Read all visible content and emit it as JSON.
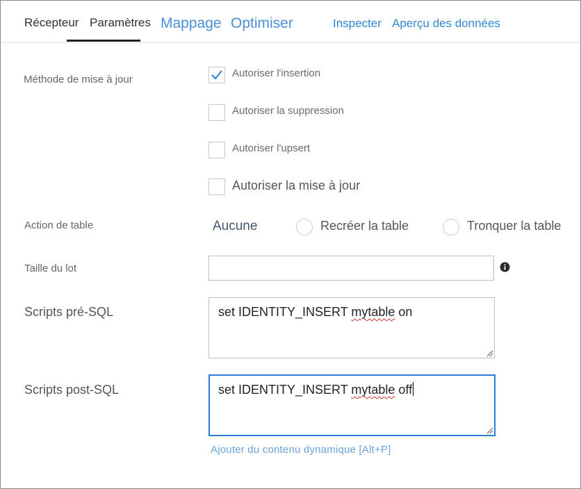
{
  "tabs": {
    "recepteur": "Récepteur",
    "parametres": "Paramètres",
    "mappage": "Mappage",
    "optimiser": "Optimiser",
    "inspecter": "Inspecter",
    "apercu": "Aperçu des données",
    "active": "Paramètres"
  },
  "update_method": {
    "label": "Méthode de mise à jour",
    "options": [
      {
        "label": "Autoriser l'insertion",
        "checked": true
      },
      {
        "label": "Autoriser la suppression",
        "checked": false
      },
      {
        "label": "Autoriser l'upsert",
        "checked": false
      },
      {
        "label": "Autoriser la mise à jour",
        "checked": false
      }
    ]
  },
  "table_action": {
    "label": "Action de table",
    "selected": "Aucune",
    "options": [
      "Aucune",
      "Recréer la table",
      "Tronquer la table"
    ]
  },
  "batch_size": {
    "label": "Taille du lot",
    "value": "",
    "info_icon": "info-icon"
  },
  "pre_sql": {
    "label": "Scripts pré-SQL",
    "value_prefix": "set IDENTITY_INSERT ",
    "value_flagged": "mytable",
    "value_suffix": " on"
  },
  "post_sql": {
    "label": "Scripts post-SQL",
    "value_prefix": "set IDENTITY_INSERT ",
    "value_flagged": "mytable",
    "value_suffix": " off"
  },
  "dynamic_content_link": "Ajouter du contenu dynamique [Alt+P]",
  "colors": {
    "link": "#2f86d4",
    "focus_border": "#2b7cd3",
    "check": "#2b7cd3",
    "spellcheck": "#d03030"
  }
}
